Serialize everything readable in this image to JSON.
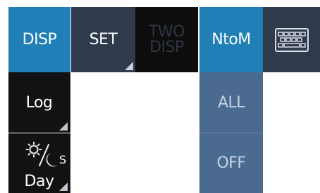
{
  "top_row": {
    "disp_label": "DISP",
    "set_label": "SET",
    "two_disp_line1": "TWO",
    "two_disp_line2": "DISP",
    "ntom_label": "NtoM",
    "keyboard_icon": "keyboard-icon"
  },
  "left_column": {
    "log_label": "Log",
    "daynight_icon": "day-night-icon",
    "daynight_s": "S",
    "daynight_label": "Day"
  },
  "mode_column": {
    "all_label": "ALL",
    "off_label": "OFF"
  },
  "colors": {
    "active_blue": "#1f7fb6",
    "slate": "#2f3a4c",
    "dark": "#121212",
    "muted_blue": "#4b6a90"
  }
}
